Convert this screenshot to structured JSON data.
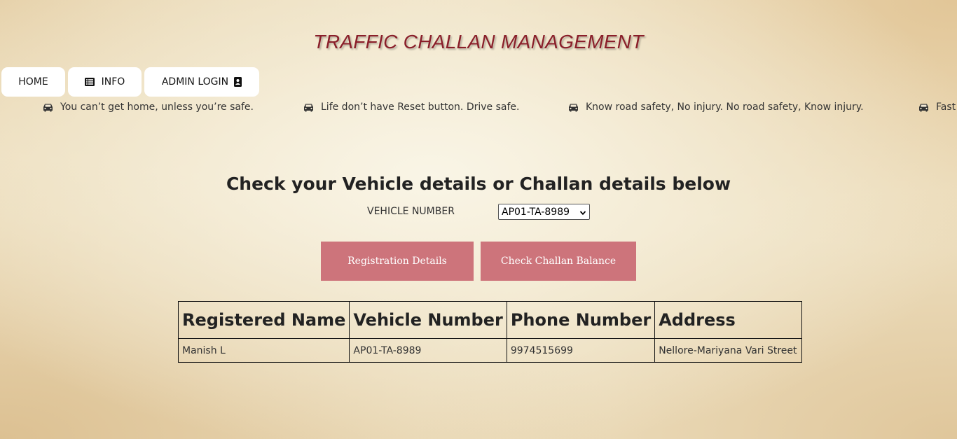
{
  "app": {
    "title": "TRAFFIC CHALLAN MANAGEMENT"
  },
  "nav": {
    "home_label": "HOME",
    "info_label": "INFO",
    "admin_label": "ADMIN LOGIN"
  },
  "marquee": {
    "items": [
      "You can’t get home, unless you’re safe.",
      "Life don’t have Reset button. Drive safe.",
      "Know road safety, No injury. No road safety, Know injury.",
      "Fast"
    ],
    "icon": "car-icon"
  },
  "main": {
    "heading": "Check your Vehicle details or Challan details below",
    "vehicle_label": "VEHICLE NUMBER",
    "vehicle_selected": "AP01-TA-8989",
    "registration_button": "Registration Details",
    "challan_button": "Check Challan Balance"
  },
  "table": {
    "headers": [
      "Registered Name",
      "Vehicle Number",
      "Phone Number",
      "Address"
    ],
    "rows": [
      [
        "Manish L",
        "AP01-TA-8989",
        "9974515699",
        "Nellore-Mariyana Vari Street"
      ]
    ]
  },
  "colors": {
    "title": "#8a1f2a",
    "button": "#cd747b",
    "nav_bg": "#ffffff"
  }
}
